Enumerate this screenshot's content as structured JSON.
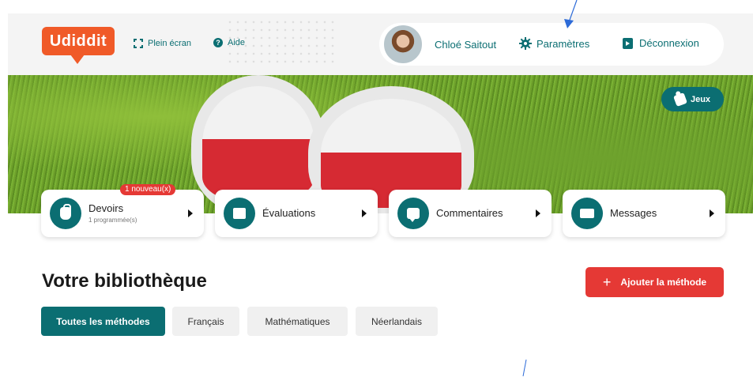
{
  "header": {
    "logo": "Udiddit",
    "fullscreen_label": "Plein écran",
    "help_label": "Aide",
    "user_name": "Chloé Saitout",
    "settings_label": "Paramètres",
    "logout_label": "Déconnexion"
  },
  "hero": {
    "games_label": "Jeux"
  },
  "cards": [
    {
      "title": "Devoirs",
      "subtitle": "1 programmée(s)",
      "badge": "1 nouveau(x)",
      "icon": "bag-icon"
    },
    {
      "title": "Évaluations",
      "icon": "evaluation-icon"
    },
    {
      "title": "Commentaires",
      "icon": "comment-icon"
    },
    {
      "title": "Messages",
      "icon": "mail-icon"
    }
  ],
  "library": {
    "title": "Votre bibliothèque",
    "add_label": "Ajouter la méthode",
    "tabs": [
      {
        "label": "Toutes les méthodes",
        "active": true
      },
      {
        "label": "Français",
        "active": false
      },
      {
        "label": "Mathématiques",
        "active": false
      },
      {
        "label": "Néerlandais",
        "active": false
      }
    ]
  },
  "colors": {
    "brand_orange": "#f05a28",
    "teal": "#0b6e72",
    "red": "#e53935",
    "annotation_blue": "#2d6bd8"
  }
}
